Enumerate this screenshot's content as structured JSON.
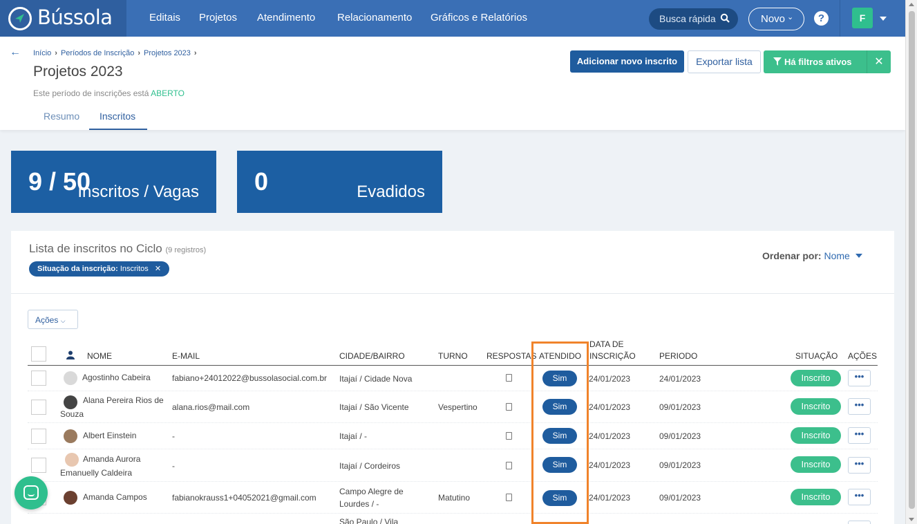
{
  "app": {
    "name": "Bússola"
  },
  "nav": {
    "items": [
      "Editais",
      "Projetos",
      "Atendimento",
      "Relacionamento",
      "Gráficos e Relatórios"
    ],
    "search_label": "Busca rápida",
    "novo_label": "Novo",
    "help_label": "?",
    "user_initial": "F"
  },
  "breadcrumb": [
    "Início",
    "Períodos de Inscrição",
    "Projetos 2023"
  ],
  "page": {
    "title": "Projetos 2023",
    "status_text": "Este período de inscrições está",
    "status_value": "ABERTO"
  },
  "tabs": [
    "Resumo",
    "Inscritos"
  ],
  "actions": {
    "add_label": "Adicionar novo inscrito",
    "export_label": "Exportar lista",
    "filters_label": "Há filtros ativos",
    "clear_filter": "✕"
  },
  "stats": [
    {
      "value": "9 / 50",
      "label": "Inscritos / Vagas"
    },
    {
      "value": "0",
      "label": "Evadidos"
    }
  ],
  "list": {
    "title": "Lista de inscritos no Ciclo",
    "count": "(9 registros)",
    "chip_label": "Situação da inscrição:",
    "chip_value": "Inscritos",
    "chip_close": "✕",
    "order_label": "Ordenar por:",
    "order_value": "Nome",
    "acoes_label": "Ações"
  },
  "columns": [
    "NOME",
    "E-MAIL",
    "CIDADE/BAIRRO",
    "TURNO",
    "RESPOSTAS",
    "ATENDIDO",
    "DATA DE",
    "INSCRIÇÃO",
    "PERIODO",
    "SITUAÇÃO",
    "AÇÕES"
  ],
  "rows": [
    {
      "name1": "Agostinho Cabeira",
      "name2": "",
      "email": "fabiano+24012022@bussolasocial.com.br",
      "city1": "Itajaí / Cidade Nova",
      "city2": "",
      "turno": "",
      "atendido": "Sim",
      "data": "24/01/2023",
      "periodo": "24/01/2023",
      "situacao": "Inscrito",
      "acoes": "•••"
    },
    {
      "name1": "Alana Pereira Rios de",
      "name2": "Souza",
      "email": "alana.rios@mail.com",
      "city1": "Itajaí / São Vicente",
      "city2": "",
      "turno": "Vespertino",
      "atendido": "Sim",
      "data": "24/01/2023",
      "periodo": "09/01/2023",
      "situacao": "Inscrito",
      "acoes": "•••"
    },
    {
      "name1": "Albert Einstein",
      "name2": "",
      "email": "-",
      "city1": "Itajaí / -",
      "city2": "",
      "turno": "",
      "atendido": "Sim",
      "data": "24/01/2023",
      "periodo": "09/01/2023",
      "situacao": "Inscrito",
      "acoes": "•••"
    },
    {
      "name1": "Amanda Aurora",
      "name2": "Emanuelly Caldeira",
      "email": "-",
      "city1": "Itajaí / Cordeiros",
      "city2": "",
      "turno": "",
      "atendido": "Sim",
      "data": "24/01/2023",
      "periodo": "09/01/2023",
      "situacao": "Inscrito",
      "acoes": "•••"
    },
    {
      "name1": "Amanda Campos",
      "name2": "",
      "email": "fabianokrauss1+04052021@gmail.com",
      "city1": "Campo Alegre de",
      "city2": "Lourdes / -",
      "turno": "Matutino",
      "atendido": "Sim",
      "data": "24/01/2023",
      "periodo": "09/01/2023",
      "situacao": "Inscrito",
      "acoes": "•••"
    },
    {
      "name1": "",
      "name2": "",
      "email": "",
      "city1": "São Paulo / Vila",
      "city2": "",
      "turno": "",
      "atendido": "",
      "data": "",
      "periodo": "",
      "situacao": "",
      "acoes": ""
    }
  ],
  "colors": {
    "brand": "#3a6fb5",
    "accent": "#2fbf8e",
    "primary": "#1f5c9e",
    "highlight": "#f0832b"
  }
}
